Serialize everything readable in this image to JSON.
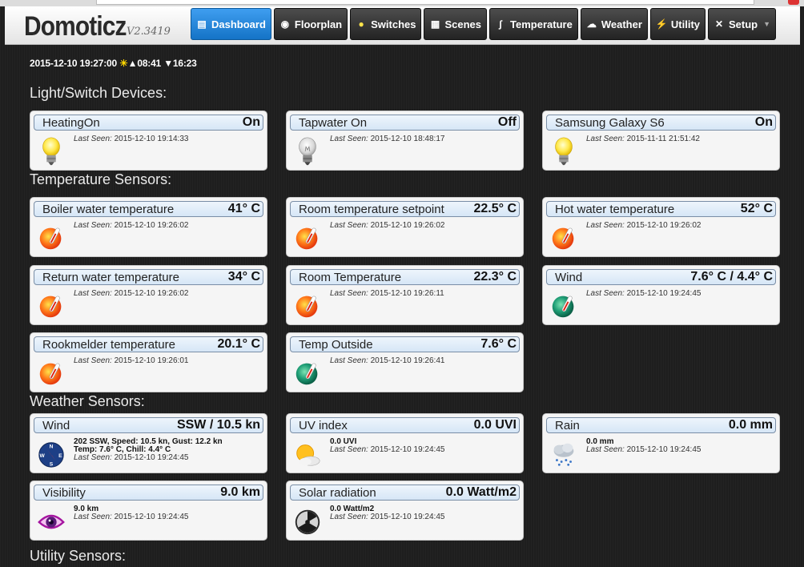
{
  "app": {
    "name": "Domoticz",
    "version": "V2.3419"
  },
  "menu": [
    {
      "label": "Dashboard",
      "icon": "dashboard-icon",
      "active": true
    },
    {
      "label": "Floorplan",
      "icon": "floorplan-icon"
    },
    {
      "label": "Switches",
      "icon": "lightbulb-icon"
    },
    {
      "label": "Scenes",
      "icon": "scenes-icon"
    },
    {
      "label": "Temperature",
      "icon": "thermometer-icon"
    },
    {
      "label": "Weather",
      "icon": "weather-icon"
    },
    {
      "label": "Utility",
      "icon": "utility-icon"
    },
    {
      "label": "Setup",
      "icon": "setup-icon"
    }
  ],
  "status": {
    "datetime": "2015-12-10 19:27:00",
    "sunrise": "08:41",
    "sunset": "16:23"
  },
  "sections": {
    "switches": "Light/Switch Devices:",
    "temperature": "Temperature Sensors:",
    "weather": "Weather Sensors:",
    "utility": "Utility Sensors:"
  },
  "last_seen_label": "Last Seen:",
  "switches": [
    {
      "name": "HeatingOn",
      "value": "On",
      "last_seen": "2015-12-10 19:14:33",
      "icon": "lightbulb-on-icon"
    },
    {
      "name": "Tapwater On",
      "value": "Off",
      "last_seen": "2015-12-10 18:48:17",
      "icon": "lightbulb-off-icon"
    },
    {
      "name": "Samsung Galaxy S6",
      "value": "On",
      "last_seen": "2015-11-11 21:51:42",
      "icon": "lightbulb-on-icon"
    }
  ],
  "temperature": [
    {
      "name": "Boiler water temperature",
      "value": "41° C",
      "last_seen": "2015-12-10 19:26:02",
      "icon": "temp-hot-icon"
    },
    {
      "name": "Room temperature setpoint",
      "value": "22.5° C",
      "last_seen": "2015-12-10 19:26:02",
      "icon": "temp-hot-icon"
    },
    {
      "name": "Hot water temperature",
      "value": "52° C",
      "last_seen": "2015-12-10 19:26:02",
      "icon": "temp-hot-icon"
    },
    {
      "name": "Return water temperature",
      "value": "34° C",
      "last_seen": "2015-12-10 19:26:02",
      "icon": "temp-hot-icon"
    },
    {
      "name": "Room Temperature",
      "value": "22.3° C",
      "last_seen": "2015-12-10 19:26:11",
      "icon": "temp-hot-icon"
    },
    {
      "name": "Wind",
      "value": "7.6° C / 4.4° C",
      "last_seen": "2015-12-10 19:24:45",
      "icon": "temp-cold-icon"
    },
    {
      "name": "Rookmelder temperature",
      "value": "20.1° C",
      "last_seen": "2015-12-10 19:26:01",
      "icon": "temp-hot-icon"
    },
    {
      "name": "Temp Outside",
      "value": "7.6° C",
      "last_seen": "2015-12-10 19:26:41",
      "icon": "temp-cold-icon"
    }
  ],
  "weather": [
    {
      "name": "Wind",
      "value": "SSW / 10.5 kn",
      "line1": "202 SSW, Speed: 10.5 kn, Gust: 12.2 kn",
      "line2": "Temp: 7.6° C, Chill: 4.4° C",
      "last_seen": "2015-12-10 19:24:45",
      "icon": "compass-icon"
    },
    {
      "name": "UV index",
      "value": "0.0 UVI",
      "line1": "0.0 UVI",
      "last_seen": "2015-12-10 19:24:45",
      "icon": "uv-sun-icon"
    },
    {
      "name": "Rain",
      "value": "0.0 mm",
      "line1": "0.0 mm",
      "last_seen": "2015-12-10 19:24:45",
      "icon": "rain-cloud-icon"
    },
    {
      "name": "Visibility",
      "value": "9.0 km",
      "line1": "9.0 km",
      "last_seen": "2015-12-10 19:24:45",
      "icon": "eye-icon"
    },
    {
      "name": "Solar radiation",
      "value": "0.0 Watt/m2",
      "line1": "0.0 Watt/m2",
      "last_seen": "2015-12-10 19:24:45",
      "icon": "radiation-icon"
    }
  ]
}
